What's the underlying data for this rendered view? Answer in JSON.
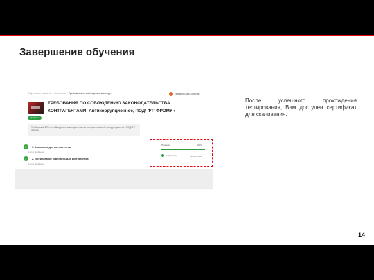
{
  "slide": {
    "title": "Завершение обучения",
    "page_number": "14"
  },
  "screenshot": {
    "breadcrumbs": [
      "Обучение и развитие",
      "Комплаенс"
    ],
    "breadcrumb_current": "Требования по соблюдению законод...",
    "user_name": "Фамилия Имя Отчество",
    "course_title": "ТРЕБОВАНИЯ ПО СОБЛЮДЕНИЮ ЗАКОНОДАТЕЛЬСТВА КОНТРАГЕНТАМИ: Антикоррупционное, ПОД/ ФТ/ ФРОМУ",
    "course_title_chevron": "›",
    "status_badge": "Пройдено",
    "description": "Требования ФГО по соблюдению законодательства контрагентами: Антикоррупционное, ПОД/ФТ/ФРОМУ",
    "items": [
      {
        "label": "1. Комплаенс для контрагентов",
        "sub": "1 из 1 пройдено"
      },
      {
        "label": "2. Тестирование комплаенс для контрагентов",
        "sub": "1 из 1 пройдено"
      }
    ],
    "certificate": {
      "progress_label": "Прогресс",
      "progress_value": "100%",
      "progress_fraction": 1.0,
      "cert_label": "Сертификат",
      "cert_action": "Скачать PDF"
    }
  },
  "note": "После успешного прохождения тестирования, Вам доступен сертификат для скачивания.",
  "colors": {
    "accent_red": "#e30613",
    "success_green": "#2e9e44",
    "page_bg": "#000000"
  }
}
